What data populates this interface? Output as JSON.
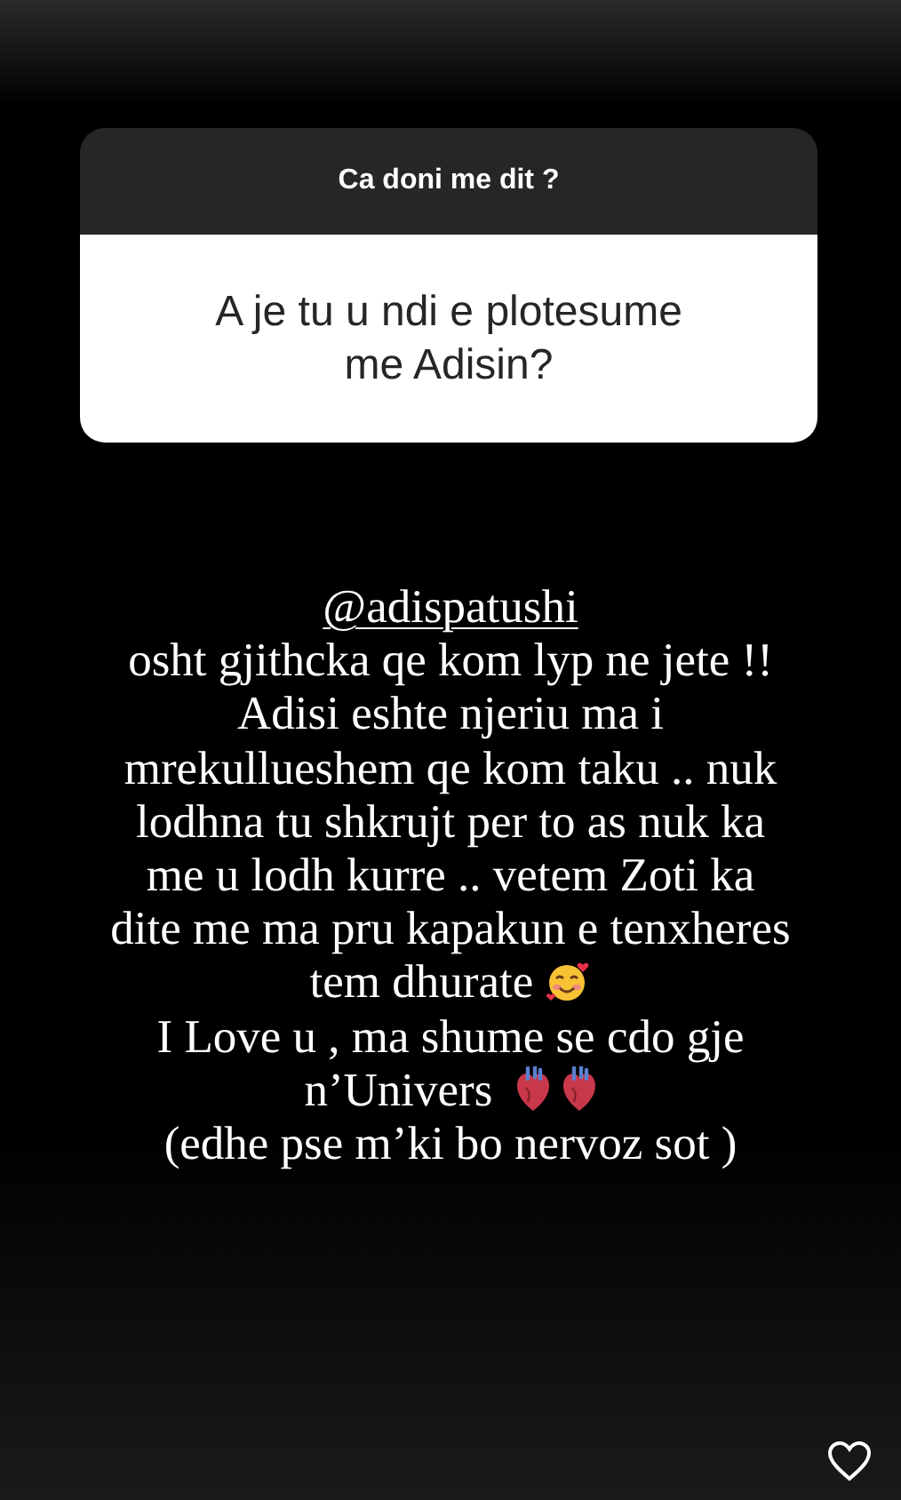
{
  "question_sticker": {
    "prompt": "Ca doni me dit ?",
    "answer": [
      "A je tu u ndi e plotesume",
      "me Adisin?"
    ]
  },
  "caption": {
    "mention": "@adispatushi",
    "lines": [
      {
        "text": "osht gjithcka qe kom lyp ne jete !!",
        "kind": "plain"
      },
      {
        "text": "Adisi eshte njeriu ma i",
        "kind": "plain"
      },
      {
        "text": "mrekullueshem qe kom taku .. nuk",
        "kind": "plain"
      },
      {
        "text": "lodhna tu shkrujt per to as nuk ka",
        "kind": "plain"
      },
      {
        "text": "me u lodh kurre .. vetem Zoti ka",
        "kind": "plain"
      },
      {
        "text": "dite me ma pru kapakun e tenxheres",
        "kind": "plain"
      },
      {
        "text": "tem dhurate",
        "kind": "smiley"
      },
      {
        "text": "I Love u , ma shume se cdo gje",
        "kind": "plain"
      },
      {
        "text": "n’Univers",
        "kind": "hearts"
      },
      {
        "text": "(edhe pse m’ki bo nervoz sot )",
        "kind": "plain"
      }
    ]
  },
  "like_button": {
    "liked": false
  }
}
